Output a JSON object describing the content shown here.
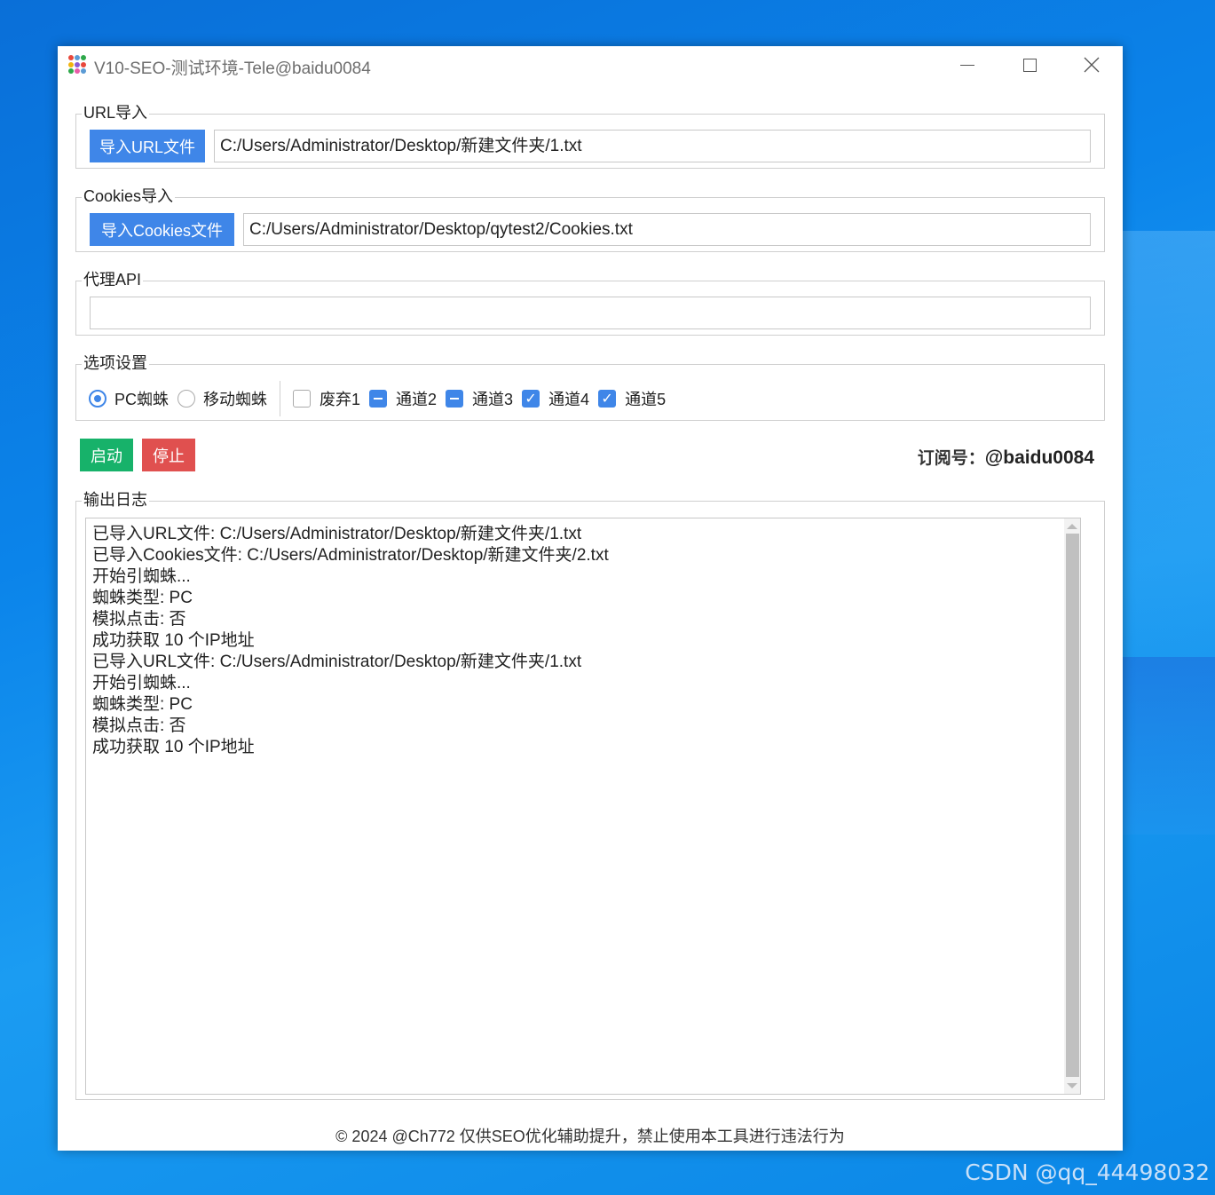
{
  "window": {
    "title": "V10-SEO-测试环境-Tele@baidu0084",
    "icon_colors": [
      "#e8483c",
      "#5b9bd5",
      "#2ea84a",
      "#f2b40f",
      "#8a5bd5",
      "#e8483c",
      "#2ea84a",
      "#e85ca8",
      "#5b9bd5"
    ]
  },
  "url_group": {
    "label": "URL导入",
    "button_label": "导入URL文件",
    "path_value": "C:/Users/Administrator/Desktop/新建文件夹/1.txt"
  },
  "cookies_group": {
    "label": "Cookies导入",
    "button_label": "导入Cookies文件",
    "path_value": "C:/Users/Administrator/Desktop/qytest2/Cookies.txt"
  },
  "proxy_group": {
    "label": "代理API",
    "value": ""
  },
  "options_group": {
    "label": "选项设置",
    "radios": [
      {
        "label": "PC蜘蛛",
        "checked": true
      },
      {
        "label": "移动蜘蛛",
        "checked": false
      }
    ],
    "checkboxes": [
      {
        "label": "废弃1",
        "state": "unchecked"
      },
      {
        "label": "通道2",
        "state": "indeterminate"
      },
      {
        "label": "通道3",
        "state": "indeterminate"
      },
      {
        "label": "通道4",
        "state": "checked"
      },
      {
        "label": "通道5",
        "state": "checked"
      }
    ]
  },
  "actions": {
    "start_label": "启动",
    "stop_label": "停止",
    "subscription_prefix": "订阅号：",
    "subscription_id": "@baidu0084"
  },
  "log_group": {
    "label": "输出日志",
    "lines": [
      "已导入URL文件: C:/Users/Administrator/Desktop/新建文件夹/1.txt",
      "已导入Cookies文件: C:/Users/Administrator/Desktop/新建文件夹/2.txt",
      "开始引蜘蛛...",
      "蜘蛛类型: PC",
      "模拟点击: 否",
      "成功获取 10 个IP地址",
      "已导入URL文件: C:/Users/Administrator/Desktop/新建文件夹/1.txt",
      "开始引蜘蛛...",
      "蜘蛛类型: PC",
      "模拟点击: 否",
      "成功获取 10 个IP地址"
    ]
  },
  "footer": {
    "text": "© 2024 @Ch772 仅供SEO优化辅助提升，禁止使用本工具进行违法行为"
  },
  "watermark": {
    "text": "CSDN @qq_44498032"
  },
  "colors": {
    "accent_blue": "#3f86e8",
    "start_green": "#17b26a",
    "stop_red": "#e0504f"
  }
}
